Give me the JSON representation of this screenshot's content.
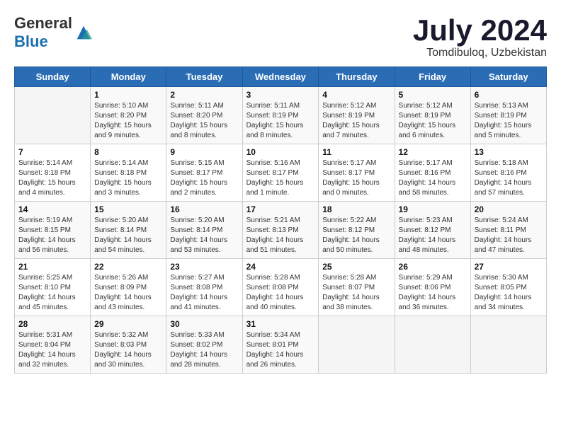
{
  "header": {
    "logo_general": "General",
    "logo_blue": "Blue",
    "month_title": "July 2024",
    "location": "Tomdibuloq, Uzbekistan"
  },
  "days_of_week": [
    "Sunday",
    "Monday",
    "Tuesday",
    "Wednesday",
    "Thursday",
    "Friday",
    "Saturday"
  ],
  "weeks": [
    [
      {
        "day": "",
        "content": ""
      },
      {
        "day": "1",
        "content": "Sunrise: 5:10 AM\nSunset: 8:20 PM\nDaylight: 15 hours\nand 9 minutes."
      },
      {
        "day": "2",
        "content": "Sunrise: 5:11 AM\nSunset: 8:20 PM\nDaylight: 15 hours\nand 8 minutes."
      },
      {
        "day": "3",
        "content": "Sunrise: 5:11 AM\nSunset: 8:19 PM\nDaylight: 15 hours\nand 8 minutes."
      },
      {
        "day": "4",
        "content": "Sunrise: 5:12 AM\nSunset: 8:19 PM\nDaylight: 15 hours\nand 7 minutes."
      },
      {
        "day": "5",
        "content": "Sunrise: 5:12 AM\nSunset: 8:19 PM\nDaylight: 15 hours\nand 6 minutes."
      },
      {
        "day": "6",
        "content": "Sunrise: 5:13 AM\nSunset: 8:19 PM\nDaylight: 15 hours\nand 5 minutes."
      }
    ],
    [
      {
        "day": "7",
        "content": "Sunrise: 5:14 AM\nSunset: 8:18 PM\nDaylight: 15 hours\nand 4 minutes."
      },
      {
        "day": "8",
        "content": "Sunrise: 5:14 AM\nSunset: 8:18 PM\nDaylight: 15 hours\nand 3 minutes."
      },
      {
        "day": "9",
        "content": "Sunrise: 5:15 AM\nSunset: 8:17 PM\nDaylight: 15 hours\nand 2 minutes."
      },
      {
        "day": "10",
        "content": "Sunrise: 5:16 AM\nSunset: 8:17 PM\nDaylight: 15 hours\nand 1 minute."
      },
      {
        "day": "11",
        "content": "Sunrise: 5:17 AM\nSunset: 8:17 PM\nDaylight: 15 hours\nand 0 minutes."
      },
      {
        "day": "12",
        "content": "Sunrise: 5:17 AM\nSunset: 8:16 PM\nDaylight: 14 hours\nand 58 minutes."
      },
      {
        "day": "13",
        "content": "Sunrise: 5:18 AM\nSunset: 8:16 PM\nDaylight: 14 hours\nand 57 minutes."
      }
    ],
    [
      {
        "day": "14",
        "content": "Sunrise: 5:19 AM\nSunset: 8:15 PM\nDaylight: 14 hours\nand 56 minutes."
      },
      {
        "day": "15",
        "content": "Sunrise: 5:20 AM\nSunset: 8:14 PM\nDaylight: 14 hours\nand 54 minutes."
      },
      {
        "day": "16",
        "content": "Sunrise: 5:20 AM\nSunset: 8:14 PM\nDaylight: 14 hours\nand 53 minutes."
      },
      {
        "day": "17",
        "content": "Sunrise: 5:21 AM\nSunset: 8:13 PM\nDaylight: 14 hours\nand 51 minutes."
      },
      {
        "day": "18",
        "content": "Sunrise: 5:22 AM\nSunset: 8:12 PM\nDaylight: 14 hours\nand 50 minutes."
      },
      {
        "day": "19",
        "content": "Sunrise: 5:23 AM\nSunset: 8:12 PM\nDaylight: 14 hours\nand 48 minutes."
      },
      {
        "day": "20",
        "content": "Sunrise: 5:24 AM\nSunset: 8:11 PM\nDaylight: 14 hours\nand 47 minutes."
      }
    ],
    [
      {
        "day": "21",
        "content": "Sunrise: 5:25 AM\nSunset: 8:10 PM\nDaylight: 14 hours\nand 45 minutes."
      },
      {
        "day": "22",
        "content": "Sunrise: 5:26 AM\nSunset: 8:09 PM\nDaylight: 14 hours\nand 43 minutes."
      },
      {
        "day": "23",
        "content": "Sunrise: 5:27 AM\nSunset: 8:08 PM\nDaylight: 14 hours\nand 41 minutes."
      },
      {
        "day": "24",
        "content": "Sunrise: 5:28 AM\nSunset: 8:08 PM\nDaylight: 14 hours\nand 40 minutes."
      },
      {
        "day": "25",
        "content": "Sunrise: 5:28 AM\nSunset: 8:07 PM\nDaylight: 14 hours\nand 38 minutes."
      },
      {
        "day": "26",
        "content": "Sunrise: 5:29 AM\nSunset: 8:06 PM\nDaylight: 14 hours\nand 36 minutes."
      },
      {
        "day": "27",
        "content": "Sunrise: 5:30 AM\nSunset: 8:05 PM\nDaylight: 14 hours\nand 34 minutes."
      }
    ],
    [
      {
        "day": "28",
        "content": "Sunrise: 5:31 AM\nSunset: 8:04 PM\nDaylight: 14 hours\nand 32 minutes."
      },
      {
        "day": "29",
        "content": "Sunrise: 5:32 AM\nSunset: 8:03 PM\nDaylight: 14 hours\nand 30 minutes."
      },
      {
        "day": "30",
        "content": "Sunrise: 5:33 AM\nSunset: 8:02 PM\nDaylight: 14 hours\nand 28 minutes."
      },
      {
        "day": "31",
        "content": "Sunrise: 5:34 AM\nSunset: 8:01 PM\nDaylight: 14 hours\nand 26 minutes."
      },
      {
        "day": "",
        "content": ""
      },
      {
        "day": "",
        "content": ""
      },
      {
        "day": "",
        "content": ""
      }
    ]
  ]
}
